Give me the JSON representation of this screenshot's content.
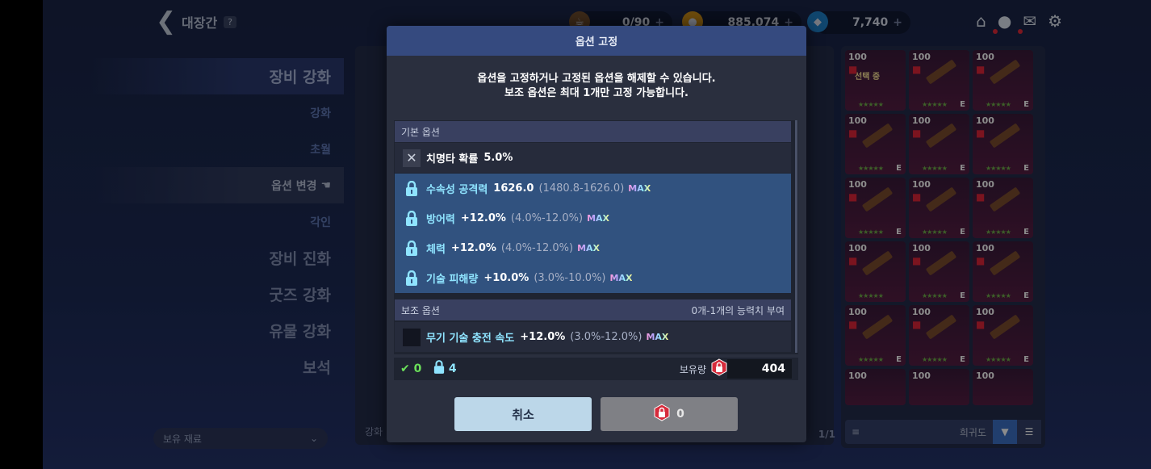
{
  "header": {
    "back_title": "대장간",
    "help": "?"
  },
  "resources": [
    {
      "value": "0/90",
      "icon": "coffee-icon"
    },
    {
      "value": "885,074",
      "icon": "gold-coin-icon"
    },
    {
      "value": "7,740",
      "icon": "diamond-icon"
    }
  ],
  "menu": {
    "items": [
      {
        "label": "장비 강화"
      },
      {
        "label": "강화"
      },
      {
        "label": "초월"
      },
      {
        "label": "옵션 변경"
      },
      {
        "label": "각인"
      },
      {
        "label": "장비 진화"
      },
      {
        "label": "굿즈 강화"
      },
      {
        "label": "유물 강화"
      },
      {
        "label": "보석"
      }
    ],
    "dropdown": "보유 재료"
  },
  "inventory": {
    "level": "100",
    "selected_tag": "선택 중",
    "grade": "E",
    "sort_label": "희귀도",
    "page": "1/1"
  },
  "modal": {
    "title": "옵션 고정",
    "desc_line1": "옵션을 고정하거나 고정된 옵션을 해제할 수 있습니다.",
    "desc_line2": "보조 옵션은 최대 1개만 고정 가능합니다.",
    "basic_section": "기본 옵션",
    "basic_options": [
      {
        "name": "치명타 확률",
        "value": "5.0%",
        "range": "",
        "max": "",
        "locked": false
      },
      {
        "name": "수속성 공격력",
        "value": "1626.0",
        "range": "(1480.8-1626.0)",
        "max": "MAX",
        "locked": true
      },
      {
        "name": "방어력",
        "value": "+12.0%",
        "range": "(4.0%-12.0%)",
        "max": "MAX",
        "locked": true
      },
      {
        "name": "체력",
        "value": "+12.0%",
        "range": "(4.0%-12.0%)",
        "max": "MAX",
        "locked": true
      },
      {
        "name": "기술 피해량",
        "value": "+10.0%",
        "range": "(3.0%-10.0%)",
        "max": "MAX",
        "locked": true
      }
    ],
    "sub_section": "보조 옵션",
    "sub_section_note": "0개-1개의 능력치 부여",
    "sub_options": [
      {
        "name": "무기 기술 충전 속도",
        "value": "+12.0%",
        "range": "(3.0%-12.0%)",
        "max": "MAX",
        "locked": false
      }
    ],
    "status": {
      "checked": "0",
      "locked": "4",
      "holding_label": "보유량",
      "holding": "404"
    },
    "cancel": "취소",
    "confirm_cost": "0"
  },
  "bg_labels": {
    "center_button": "강화"
  },
  "colors": {
    "accent": "#3d72c7",
    "locked_row": "#31527f",
    "lock_icon": "#8fe4ff",
    "max_gradient": "#ff9ad8"
  }
}
